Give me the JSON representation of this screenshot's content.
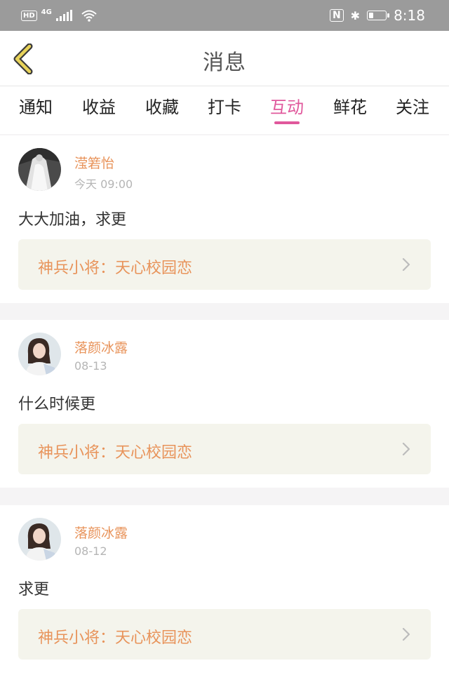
{
  "status_bar": {
    "hd_label": "HD",
    "network_label": "4G",
    "time": "8:18",
    "nfc_label": "N",
    "bluetooth_glyph": "✱",
    "battery_level": 0.3
  },
  "header": {
    "title": "消息"
  },
  "tabs": [
    {
      "label": "通知"
    },
    {
      "label": "收益"
    },
    {
      "label": "收藏"
    },
    {
      "label": "打卡"
    },
    {
      "label": "互动",
      "active": true
    },
    {
      "label": "鲜花"
    },
    {
      "label": "关注"
    }
  ],
  "messages": [
    {
      "user": "滢箬怡",
      "time": "今天 09:00",
      "text": "大大加油，求更",
      "book": "神兵小将：天心校园恋"
    },
    {
      "user": "落颜冰露",
      "time": "08-13",
      "text": "什么时候更",
      "book": "神兵小将：天心校园恋"
    },
    {
      "user": "落颜冰露",
      "time": "08-12",
      "text": "求更",
      "book": "神兵小将：天心校园恋"
    }
  ],
  "colors": {
    "accent": "#e0589c",
    "username": "#e8935a",
    "status_bar": "#9b9b9b",
    "back_arrow": "#e8d35a"
  }
}
